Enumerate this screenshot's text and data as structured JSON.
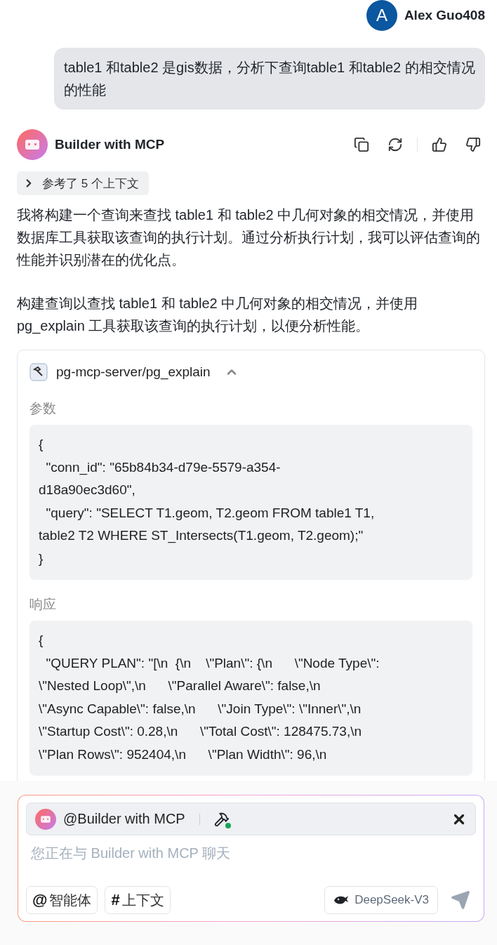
{
  "user": {
    "name": "Alex Guo408",
    "avatar_letter": "A",
    "message": "table1 和table2 是gis数据，分析下查询table1 和table2 的相交情况的性能"
  },
  "assistant": {
    "name": "Builder with MCP",
    "context": "参考了 5 个上下文",
    "paragraphs": [
      "我将构建一个查询来查找 table1 和 table2 中几何对象的相交情况，并使用数据库工具获取该查询的执行计划。通过分析执行计划，我可以评估查询的性能并识别潜在的优化点。",
      "构建查询以查找 table1 和 table2 中几何对象的相交情况，并使用 pg_explain 工具获取该查询的执行计划，以便分析性能。"
    ],
    "tool_call": {
      "title": "pg-mcp-server/pg_explain",
      "expanded": true,
      "params_label": "参数",
      "params_lines": [
        "{",
        "  \"conn_id\": \"65b84b34-d79e-5579-a354-",
        "d18a90ec3d60\",",
        "  \"query\": \"SELECT T1.geom, T2.geom FROM table1 T1,",
        "table2 T2 WHERE ST_Intersects(T1.geom, T2.geom);\"",
        "}"
      ],
      "response_label": "响应",
      "response_lines": [
        "{",
        "  \"QUERY PLAN\": \"[\\n  {\\n    \\\"Plan\\\": {\\n      \\\"Node Type\\\":",
        "\\\"Nested Loop\\\",\\n      \\\"Parallel Aware\\\": false,\\n",
        "\\\"Async Capable\\\": false,\\n      \\\"Join Type\\\": \\\"Inner\\\",\\n",
        "\\\"Startup Cost\\\": 0.28,\\n      \\\"Total Cost\\\": 128475.73,\\n",
        "\\\"Plan Rows\\\": 952404,\\n      \\\"Plan Width\\\": 96,\\n"
      ]
    }
  },
  "composer": {
    "agent_tag": "@Builder with MCP",
    "placeholder": "您正在与 Builder with MCP 聊天",
    "buttons": [
      {
        "symbol": "@",
        "label": "智能体"
      },
      {
        "symbol": "#",
        "label": "上下文"
      }
    ],
    "model": "DeepSeek-V3"
  }
}
